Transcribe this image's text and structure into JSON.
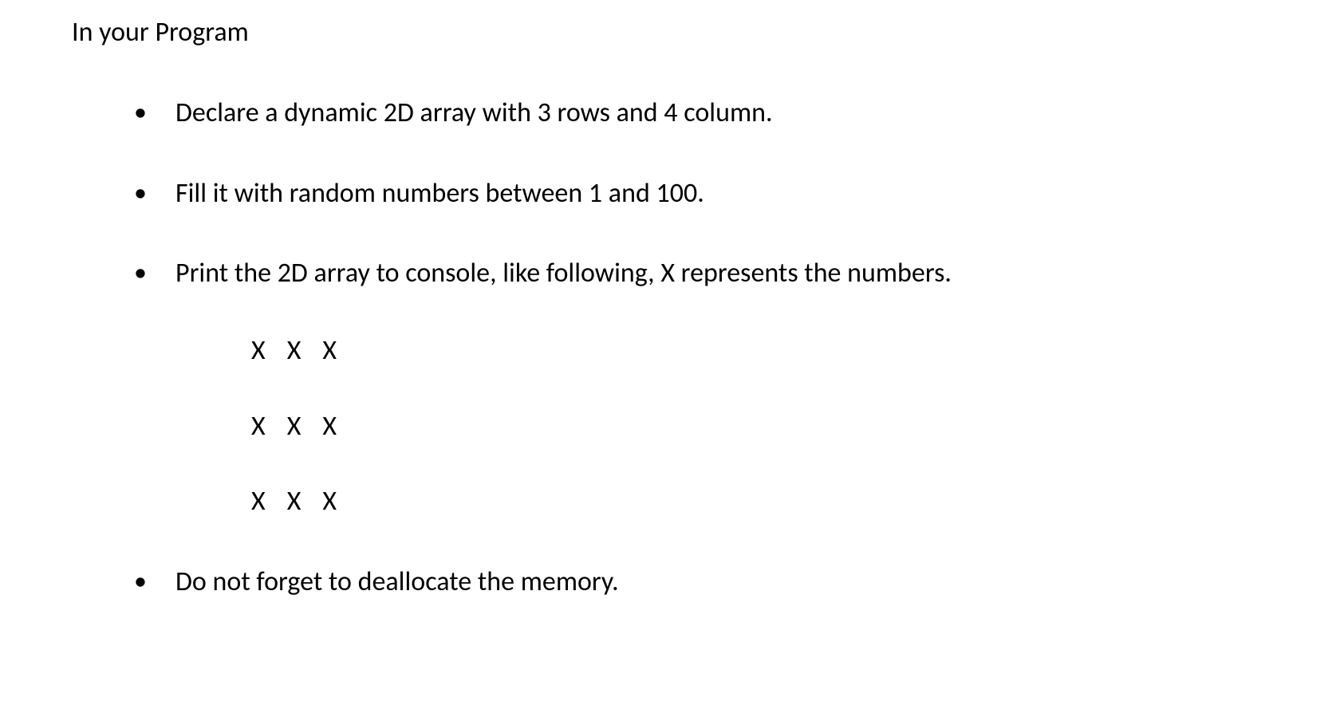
{
  "heading": "In your Program",
  "bullets": [
    {
      "text": "Declare a dynamic 2D array with 3 rows and 4 column."
    },
    {
      "text": "Fill it with random numbers between 1 and 100."
    },
    {
      "text": "Print the 2D array to console, like following, X represents the numbers.",
      "example_rows": [
        [
          "X",
          "X",
          "X"
        ],
        [
          "X",
          "X",
          "X"
        ],
        [
          "X",
          "X",
          "X"
        ]
      ]
    },
    {
      "text": "Do not forget to deallocate the memory."
    }
  ]
}
